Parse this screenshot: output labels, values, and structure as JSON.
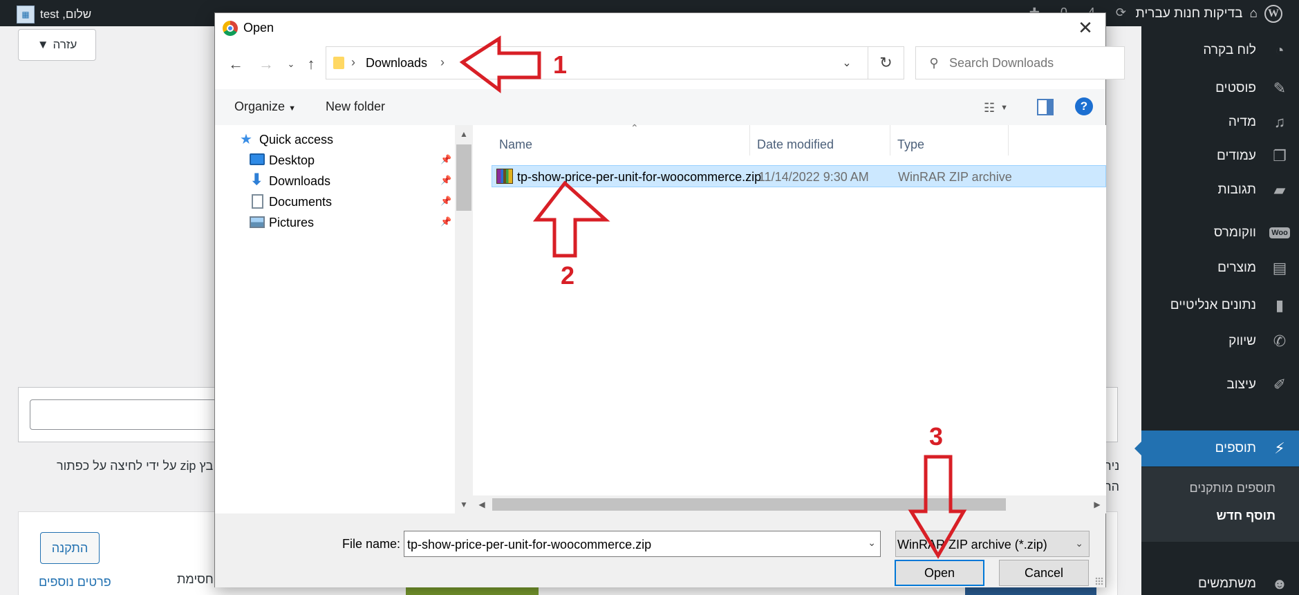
{
  "wp": {
    "greeting": "שלום, test",
    "site_name": "בדיקות חנות עברית",
    "help_button": "עזרה",
    "sidebar": [
      {
        "label": "לוח בקרה",
        "icon": "dashboard-icon"
      },
      {
        "label": "פוסטים",
        "icon": "pin-icon"
      },
      {
        "label": "מדיה",
        "icon": "media-icon"
      },
      {
        "label": "עמודים",
        "icon": "pages-icon"
      },
      {
        "label": "תגובות",
        "icon": "comments-icon"
      },
      {
        "label": "ווקומרס",
        "icon": "woo-icon"
      },
      {
        "label": "מוצרים",
        "icon": "products-icon"
      },
      {
        "label": "נתונים אנליטיים",
        "icon": "analytics-icon"
      },
      {
        "label": "שיווק",
        "icon": "megaphone-icon"
      },
      {
        "label": "עיצוב",
        "icon": "brush-icon"
      },
      {
        "label": "תוספים",
        "icon": "plugin-icon"
      },
      {
        "label": "משתמשים",
        "icon": "users-icon"
      }
    ],
    "submenu": [
      "תוספים מותקנים",
      "תוסף חדש"
    ],
    "woo_badge": "Woo",
    "upload_text_fragment": "בץ zip על ידי לחיצה על כפתור",
    "right_fragment_1": "ניר",
    "right_fragment_2": "הר",
    "heading_fragment": "ה",
    "install_button": "התקנה",
    "more_details": "פרטים נוספים",
    "desc_fragment": "חסימת",
    "adminbar_count": "4",
    "adminbar_zero": "0"
  },
  "dialog": {
    "title": "Open",
    "address_path": "Downloads",
    "search_placeholder": "Search Downloads",
    "toolbar": {
      "organize": "Organize",
      "new_folder": "New folder"
    },
    "nav_items": [
      {
        "label": "Quick access",
        "icon": "star-icon",
        "pinned": false
      },
      {
        "label": "Desktop",
        "icon": "desktop-icon",
        "pinned": true
      },
      {
        "label": "Downloads",
        "icon": "downloads-icon",
        "pinned": true
      },
      {
        "label": "Documents",
        "icon": "documents-icon",
        "pinned": true
      },
      {
        "label": "Pictures",
        "icon": "pictures-icon",
        "pinned": true
      }
    ],
    "columns": [
      "Name",
      "Date modified",
      "Type"
    ],
    "files": [
      {
        "name": "tp-show-price-per-unit-for-woocommerce.zip",
        "date": "11/14/2022 9:30 AM",
        "type": "WinRAR ZIP archive",
        "selected": true
      }
    ],
    "file_name_label": "File name:",
    "file_name_value": "tp-show-price-per-unit-for-woocommerce.zip",
    "file_type": "WinRAR ZIP archive (*.zip)",
    "open_button": "Open",
    "cancel_button": "Cancel"
  },
  "annotations": [
    "1",
    "2",
    "3"
  ],
  "colors": {
    "accent": "#d81f26",
    "wp_blue": "#2271b1",
    "selection": "#cce8ff"
  }
}
